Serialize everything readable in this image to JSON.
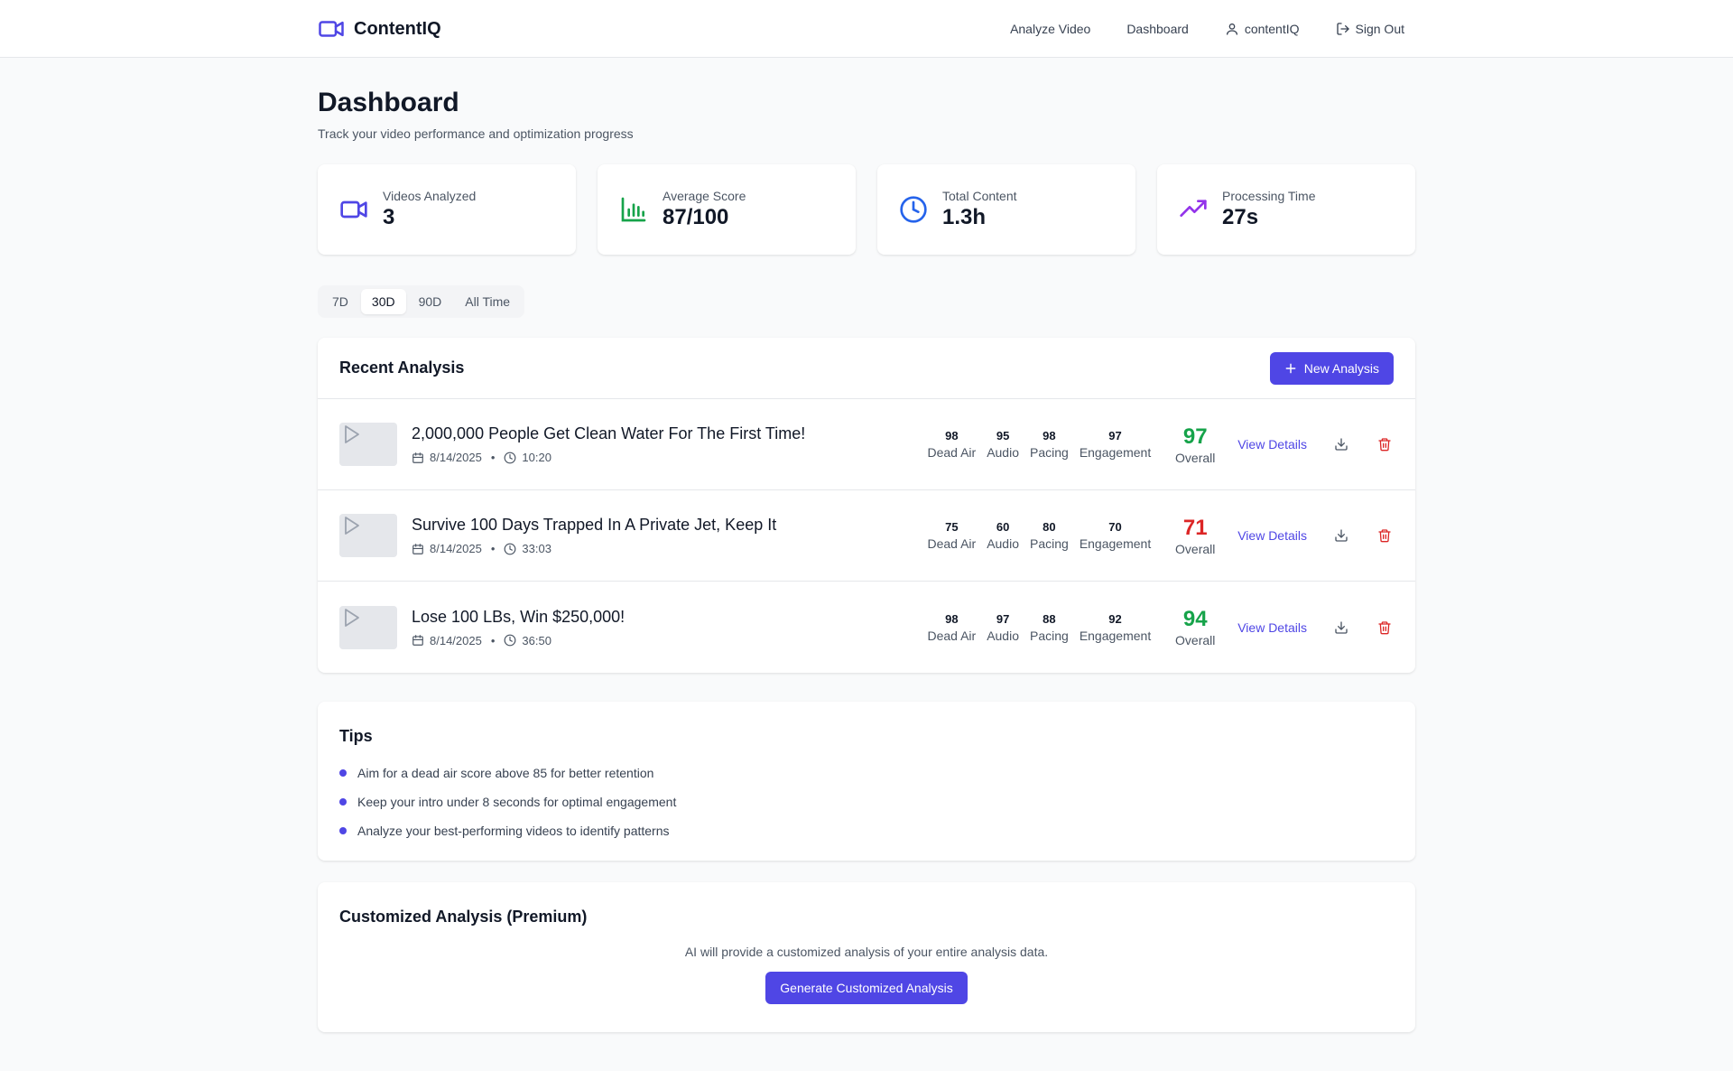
{
  "app": {
    "name": "ContentIQ"
  },
  "nav": {
    "analyze": "Analyze Video",
    "dashboard": "Dashboard",
    "user": "contentIQ",
    "signout": "Sign Out"
  },
  "page": {
    "title": "Dashboard",
    "subtitle": "Track your video performance and optimization progress"
  },
  "stats": [
    {
      "label": "Videos Analyzed",
      "value": "3",
      "icon": "video-icon",
      "color": "#4f46e5"
    },
    {
      "label": "Average Score",
      "value": "87/100",
      "icon": "bar-chart-icon",
      "color": "#16a34a"
    },
    {
      "label": "Total Content",
      "value": "1.3h",
      "icon": "clock-icon",
      "color": "#2563eb"
    },
    {
      "label": "Processing Time",
      "value": "27s",
      "icon": "trending-up-icon",
      "color": "#9333ea"
    }
  ],
  "ranges": [
    "7D",
    "30D",
    "90D",
    "All Time"
  ],
  "recent": {
    "title": "Recent Analysis",
    "new_button": "New Analysis",
    "metric_labels": {
      "dead_air": "Dead Air",
      "audio": "Audio",
      "pacing": "Pacing",
      "engagement": "Engagement",
      "overall": "Overall"
    },
    "view_label": "View Details",
    "videos": [
      {
        "title": "2,000,000 People Get Clean Water For The First Time!",
        "date": "8/14/2025",
        "duration": "10:20",
        "dead_air": "98",
        "audio": "95",
        "pacing": "98",
        "engagement": "97",
        "overall": "97",
        "overall_color": "#16a34a"
      },
      {
        "title": "Survive 100 Days Trapped In A Private Jet, Keep It",
        "date": "8/14/2025",
        "duration": "33:03",
        "dead_air": "75",
        "audio": "60",
        "pacing": "80",
        "engagement": "70",
        "overall": "71",
        "overall_color": "#dc2626"
      },
      {
        "title": "Lose 100 LBs, Win $250,000!",
        "date": "8/14/2025",
        "duration": "36:50",
        "dead_air": "98",
        "audio": "97",
        "pacing": "88",
        "engagement": "92",
        "overall": "94",
        "overall_color": "#16a34a"
      }
    ]
  },
  "tips": {
    "title": "Tips",
    "items": [
      "Aim for a dead air score above 85 for better retention",
      "Keep your intro under 8 seconds for optimal engagement",
      "Analyze your best-performing videos to identify patterns"
    ]
  },
  "premium": {
    "title": "Customized Analysis (Premium)",
    "description": "AI will provide a customized analysis of your entire analysis data.",
    "button": "Generate Customized Analysis"
  },
  "colors": {
    "accent": "#4f46e5",
    "good": "#16a34a",
    "bad": "#dc2626"
  }
}
